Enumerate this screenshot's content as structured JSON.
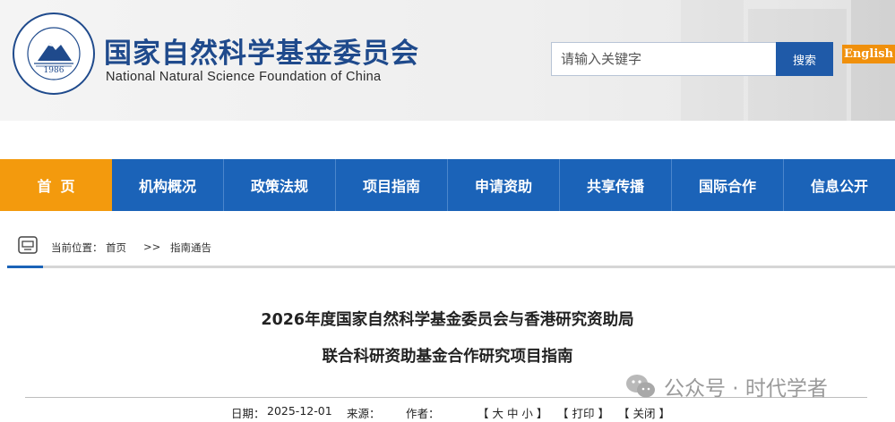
{
  "header": {
    "title_cn": "国家自然科学基金委员会",
    "title_en": "National Natural Science Foundation of China",
    "logo_year": "1986",
    "search_placeholder": "请输入关键字",
    "search_button": "搜索",
    "lang_button": "English"
  },
  "nav": {
    "items": [
      "首页",
      "机构概况",
      "政策法规",
      "项目指南",
      "申请资助",
      "共享传播",
      "国际合作",
      "信息公开"
    ],
    "active_index": 0
  },
  "breadcrumb": {
    "prefix": "当前位置：",
    "home": "首页",
    "sep": ">>",
    "current": "指南通告"
  },
  "article": {
    "title_line1": "2026年度国家自然科学基金委员会与香港研究资助局",
    "title_line2": "联合科研资助基金合作研究项目指南",
    "date_label": "日期：",
    "date": "2025-12-01",
    "source_label": "来源：",
    "author_label": "作者：",
    "font_size": "【 大 中 小 】",
    "print": "【 打印 】",
    "close": "【 关闭 】"
  },
  "watermark": {
    "text": "公众号 · 时代学者"
  },
  "colors": {
    "brand_blue": "#1f4a8c",
    "nav_blue": "#1b63b8",
    "accent_orange": "#f39a0d"
  }
}
